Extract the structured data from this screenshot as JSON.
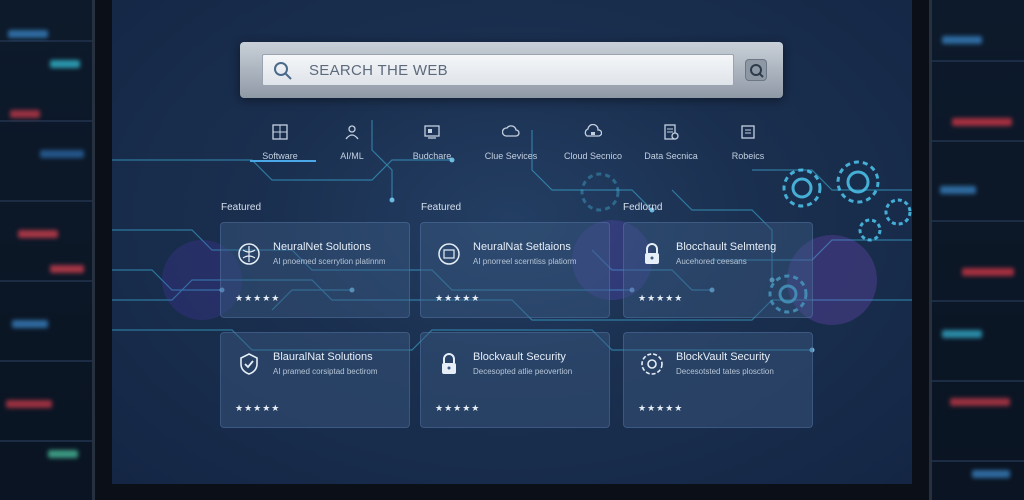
{
  "search": {
    "placeholder": "SEARCH THE WEB"
  },
  "categories": [
    {
      "label": "Software",
      "icon": "software-icon",
      "active": true
    },
    {
      "label": "AI/ML",
      "icon": "ai-ml-icon"
    },
    {
      "label": "Budchare",
      "icon": "hardware-icon"
    },
    {
      "label": "Clue Sevices",
      "icon": "cloud-services-icon"
    },
    {
      "label": "Cloud Secnico",
      "icon": "cloud-security-icon"
    },
    {
      "label": "Data Secnica",
      "icon": "data-science-icon"
    },
    {
      "label": "Robeics",
      "icon": "robotics-icon"
    }
  ],
  "featured_labels": [
    "Featured",
    "Featured",
    "Fedlornd"
  ],
  "cards": [
    {
      "name": "NeuralNet Solutions",
      "desc": "AI pnoemed scerrytion platinnm",
      "stars": "★★★★★",
      "icon": "neural-net-icon"
    },
    {
      "name": "NeuralNat Setlaions",
      "desc": "AI pnorreel scerntiss platiorm",
      "stars": "★★★★★",
      "icon": "neural-chip-icon"
    },
    {
      "name": "Blocchault Selmteng",
      "desc": "Aucehored ceesans",
      "stars": "★★★★★",
      "icon": "lock-icon"
    },
    {
      "name": "BlauralNat Solutions",
      "desc": "AI pramed corsiptad bectirom",
      "stars": "★★★★★",
      "icon": "shield-check-icon"
    },
    {
      "name": "Blockvault Security",
      "desc": "Decesopted atlie peovertion",
      "stars": "★★★★★",
      "icon": "lock-icon"
    },
    {
      "name": "BlockVault Security",
      "desc": "Decesotsted tates plosction",
      "stars": "★★★★★",
      "icon": "shield-gear-icon"
    }
  ],
  "colors": {
    "accent": "#4aa8e8",
    "circuit": "#3fb6e0",
    "card_bg": "#3c5a82"
  }
}
